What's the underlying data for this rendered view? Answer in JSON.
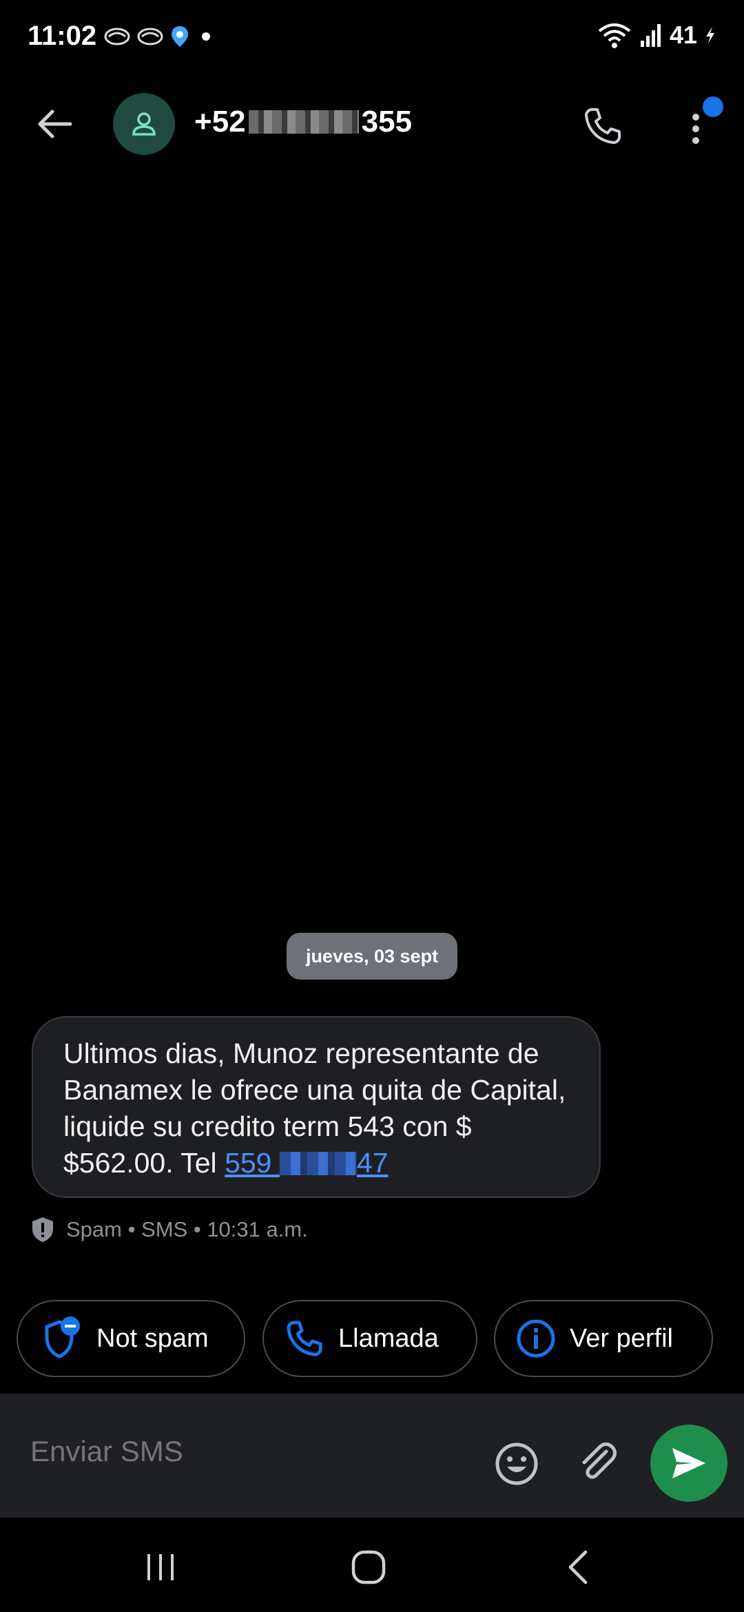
{
  "status_bar": {
    "time": "11:02",
    "battery": "41"
  },
  "header": {
    "contact_prefix": "+52",
    "contact_suffix": "355"
  },
  "conversation": {
    "date": "jueves, 03 sept",
    "message": {
      "text": "Ultimos dias, Munoz representante de Banamex le ofrece una quita de Capital, liquide su credito term 543 con $ $562.00. Tel ",
      "link_prefix": "559",
      "link_suffix": "47"
    },
    "meta": "Spam • SMS • 10:31 a.m."
  },
  "actions": {
    "not_spam": "Not spam",
    "call": "Llamada",
    "profile": "Ver perfil"
  },
  "compose": {
    "placeholder": "Enviar SMS"
  },
  "colors": {
    "accent": "#1a73e8",
    "send": "#1e8e4e",
    "link": "#4d8fff"
  }
}
